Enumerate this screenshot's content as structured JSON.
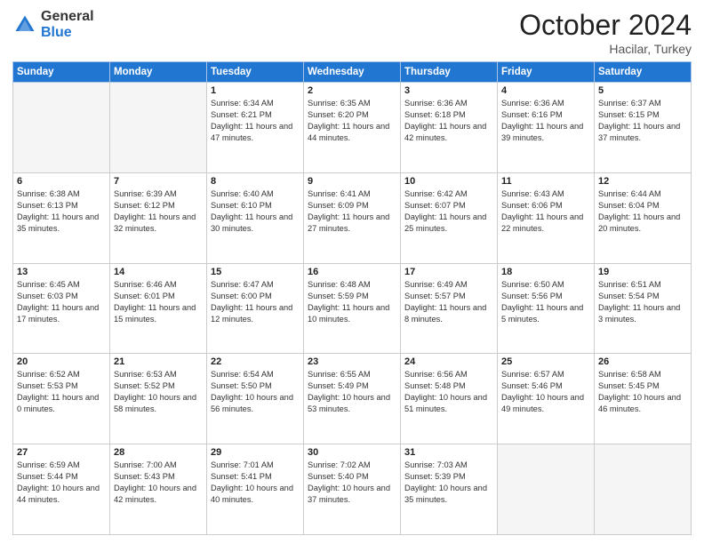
{
  "header": {
    "logo_general": "General",
    "logo_blue": "Blue",
    "month_title": "October 2024",
    "subtitle": "Hacilar, Turkey"
  },
  "days_of_week": [
    "Sunday",
    "Monday",
    "Tuesday",
    "Wednesday",
    "Thursday",
    "Friday",
    "Saturday"
  ],
  "weeks": [
    [
      {
        "day": "",
        "empty": true
      },
      {
        "day": "",
        "empty": true
      },
      {
        "day": "1",
        "sunrise": "Sunrise: 6:34 AM",
        "sunset": "Sunset: 6:21 PM",
        "daylight": "Daylight: 11 hours and 47 minutes."
      },
      {
        "day": "2",
        "sunrise": "Sunrise: 6:35 AM",
        "sunset": "Sunset: 6:20 PM",
        "daylight": "Daylight: 11 hours and 44 minutes."
      },
      {
        "day": "3",
        "sunrise": "Sunrise: 6:36 AM",
        "sunset": "Sunset: 6:18 PM",
        "daylight": "Daylight: 11 hours and 42 minutes."
      },
      {
        "day": "4",
        "sunrise": "Sunrise: 6:36 AM",
        "sunset": "Sunset: 6:16 PM",
        "daylight": "Daylight: 11 hours and 39 minutes."
      },
      {
        "day": "5",
        "sunrise": "Sunrise: 6:37 AM",
        "sunset": "Sunset: 6:15 PM",
        "daylight": "Daylight: 11 hours and 37 minutes."
      }
    ],
    [
      {
        "day": "6",
        "sunrise": "Sunrise: 6:38 AM",
        "sunset": "Sunset: 6:13 PM",
        "daylight": "Daylight: 11 hours and 35 minutes."
      },
      {
        "day": "7",
        "sunrise": "Sunrise: 6:39 AM",
        "sunset": "Sunset: 6:12 PM",
        "daylight": "Daylight: 11 hours and 32 minutes."
      },
      {
        "day": "8",
        "sunrise": "Sunrise: 6:40 AM",
        "sunset": "Sunset: 6:10 PM",
        "daylight": "Daylight: 11 hours and 30 minutes."
      },
      {
        "day": "9",
        "sunrise": "Sunrise: 6:41 AM",
        "sunset": "Sunset: 6:09 PM",
        "daylight": "Daylight: 11 hours and 27 minutes."
      },
      {
        "day": "10",
        "sunrise": "Sunrise: 6:42 AM",
        "sunset": "Sunset: 6:07 PM",
        "daylight": "Daylight: 11 hours and 25 minutes."
      },
      {
        "day": "11",
        "sunrise": "Sunrise: 6:43 AM",
        "sunset": "Sunset: 6:06 PM",
        "daylight": "Daylight: 11 hours and 22 minutes."
      },
      {
        "day": "12",
        "sunrise": "Sunrise: 6:44 AM",
        "sunset": "Sunset: 6:04 PM",
        "daylight": "Daylight: 11 hours and 20 minutes."
      }
    ],
    [
      {
        "day": "13",
        "sunrise": "Sunrise: 6:45 AM",
        "sunset": "Sunset: 6:03 PM",
        "daylight": "Daylight: 11 hours and 17 minutes."
      },
      {
        "day": "14",
        "sunrise": "Sunrise: 6:46 AM",
        "sunset": "Sunset: 6:01 PM",
        "daylight": "Daylight: 11 hours and 15 minutes."
      },
      {
        "day": "15",
        "sunrise": "Sunrise: 6:47 AM",
        "sunset": "Sunset: 6:00 PM",
        "daylight": "Daylight: 11 hours and 12 minutes."
      },
      {
        "day": "16",
        "sunrise": "Sunrise: 6:48 AM",
        "sunset": "Sunset: 5:59 PM",
        "daylight": "Daylight: 11 hours and 10 minutes."
      },
      {
        "day": "17",
        "sunrise": "Sunrise: 6:49 AM",
        "sunset": "Sunset: 5:57 PM",
        "daylight": "Daylight: 11 hours and 8 minutes."
      },
      {
        "day": "18",
        "sunrise": "Sunrise: 6:50 AM",
        "sunset": "Sunset: 5:56 PM",
        "daylight": "Daylight: 11 hours and 5 minutes."
      },
      {
        "day": "19",
        "sunrise": "Sunrise: 6:51 AM",
        "sunset": "Sunset: 5:54 PM",
        "daylight": "Daylight: 11 hours and 3 minutes."
      }
    ],
    [
      {
        "day": "20",
        "sunrise": "Sunrise: 6:52 AM",
        "sunset": "Sunset: 5:53 PM",
        "daylight": "Daylight: 11 hours and 0 minutes."
      },
      {
        "day": "21",
        "sunrise": "Sunrise: 6:53 AM",
        "sunset": "Sunset: 5:52 PM",
        "daylight": "Daylight: 10 hours and 58 minutes."
      },
      {
        "day": "22",
        "sunrise": "Sunrise: 6:54 AM",
        "sunset": "Sunset: 5:50 PM",
        "daylight": "Daylight: 10 hours and 56 minutes."
      },
      {
        "day": "23",
        "sunrise": "Sunrise: 6:55 AM",
        "sunset": "Sunset: 5:49 PM",
        "daylight": "Daylight: 10 hours and 53 minutes."
      },
      {
        "day": "24",
        "sunrise": "Sunrise: 6:56 AM",
        "sunset": "Sunset: 5:48 PM",
        "daylight": "Daylight: 10 hours and 51 minutes."
      },
      {
        "day": "25",
        "sunrise": "Sunrise: 6:57 AM",
        "sunset": "Sunset: 5:46 PM",
        "daylight": "Daylight: 10 hours and 49 minutes."
      },
      {
        "day": "26",
        "sunrise": "Sunrise: 6:58 AM",
        "sunset": "Sunset: 5:45 PM",
        "daylight": "Daylight: 10 hours and 46 minutes."
      }
    ],
    [
      {
        "day": "27",
        "sunrise": "Sunrise: 6:59 AM",
        "sunset": "Sunset: 5:44 PM",
        "daylight": "Daylight: 10 hours and 44 minutes."
      },
      {
        "day": "28",
        "sunrise": "Sunrise: 7:00 AM",
        "sunset": "Sunset: 5:43 PM",
        "daylight": "Daylight: 10 hours and 42 minutes."
      },
      {
        "day": "29",
        "sunrise": "Sunrise: 7:01 AM",
        "sunset": "Sunset: 5:41 PM",
        "daylight": "Daylight: 10 hours and 40 minutes."
      },
      {
        "day": "30",
        "sunrise": "Sunrise: 7:02 AM",
        "sunset": "Sunset: 5:40 PM",
        "daylight": "Daylight: 10 hours and 37 minutes."
      },
      {
        "day": "31",
        "sunrise": "Sunrise: 7:03 AM",
        "sunset": "Sunset: 5:39 PM",
        "daylight": "Daylight: 10 hours and 35 minutes."
      },
      {
        "day": "",
        "empty": true
      },
      {
        "day": "",
        "empty": true
      }
    ]
  ]
}
